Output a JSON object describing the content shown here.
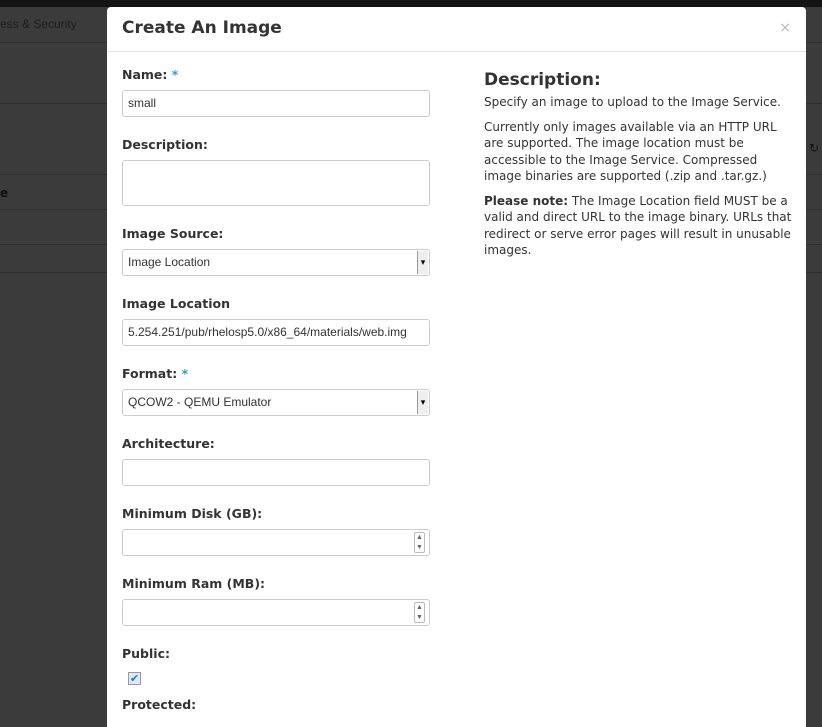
{
  "background": {
    "tab_label": "ess & Security",
    "table_header": "e"
  },
  "modal": {
    "title": "Create An Image",
    "close": "×"
  },
  "form": {
    "name": {
      "label": "Name:",
      "required": "*",
      "value": "small"
    },
    "description": {
      "label": "Description:",
      "value": ""
    },
    "image_source": {
      "label": "Image Source:",
      "value": "Image Location"
    },
    "image_location": {
      "label": "Image Location",
      "value": "5.254.251/pub/rhelosp5.0/x86_64/materials/web.img"
    },
    "format": {
      "label": "Format:",
      "required": "*",
      "value": "QCOW2 - QEMU Emulator"
    },
    "architecture": {
      "label": "Architecture:",
      "value": ""
    },
    "min_disk": {
      "label": "Minimum Disk (GB):",
      "value": ""
    },
    "min_ram": {
      "label": "Minimum Ram (MB):",
      "value": ""
    },
    "public": {
      "label": "Public:",
      "checked": true
    },
    "protected": {
      "label": "Protected:"
    }
  },
  "help": {
    "title": "Description:",
    "p1": "Specify an image to upload to the Image Service.",
    "p2": "Currently only images available via an HTTP URL are supported. The image location must be accessible to the Image Service. Compressed image binaries are supported (.zip and .tar.gz.)",
    "note_label": "Please note:",
    "p3": " The Image Location field MUST be a valid and direct URL to the image binary. URLs that redirect or serve error pages will result in unusable images."
  },
  "colors": {
    "accent": "#3b97d3"
  }
}
